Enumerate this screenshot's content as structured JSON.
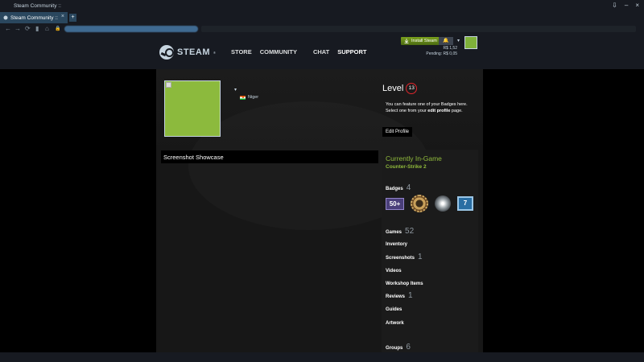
{
  "window": {
    "title": "Steam Community ::"
  },
  "tab": {
    "label": "Steam Community ::",
    "close": "×",
    "new": "+"
  },
  "window_controls": {
    "download": "⇩",
    "minimize": "–",
    "close": "×"
  },
  "nav": {
    "back": "←",
    "forward": "→",
    "reload": "⟳",
    "bookmark": "▮",
    "home": "⌂",
    "lock": "🔒"
  },
  "header": {
    "logo_text": "STEAM",
    "logo_tm": "®",
    "nav_items": [
      "STORE",
      "COMMUNITY",
      "CHAT",
      "SUPPORT"
    ],
    "install_label": "Install Steam",
    "notif": "🔔",
    "wallet_balance": "R$ 1,52",
    "wallet_pending": "Pending: R$ 0,05"
  },
  "profile": {
    "name_caret": "▾",
    "location": "Niger",
    "showcase_title": "Screenshot Showcase",
    "level_label": "Level",
    "level_value": "13",
    "badge_hint_1": "You can feature one of your Badges here.",
    "badge_hint_2": "Select one from your ",
    "badge_hint_link": "edit profile",
    "badge_hint_3": " page.",
    "edit_profile": "Edit Profile",
    "status": "Currently In-Game",
    "game": "Counter-Strike 2",
    "badges_label": "Badges",
    "badges_count": "4",
    "badge_50": "50+",
    "badge_7": "7",
    "games_label": "Games",
    "games_count": "52",
    "inventory_label": "Inventory",
    "screenshots_label": "Screenshots",
    "screenshots_count": "1",
    "videos_label": "Videos",
    "workshop_label": "Workshop Items",
    "reviews_label": "Reviews",
    "reviews_count": "1",
    "guides_label": "Guides",
    "artwork_label": "Artwork",
    "groups_label": "Groups",
    "groups_count": "6"
  },
  "colors": {
    "in_game": "#90ba3c",
    "level_ring": "#e0262c",
    "install_green": "#5c7e10"
  }
}
